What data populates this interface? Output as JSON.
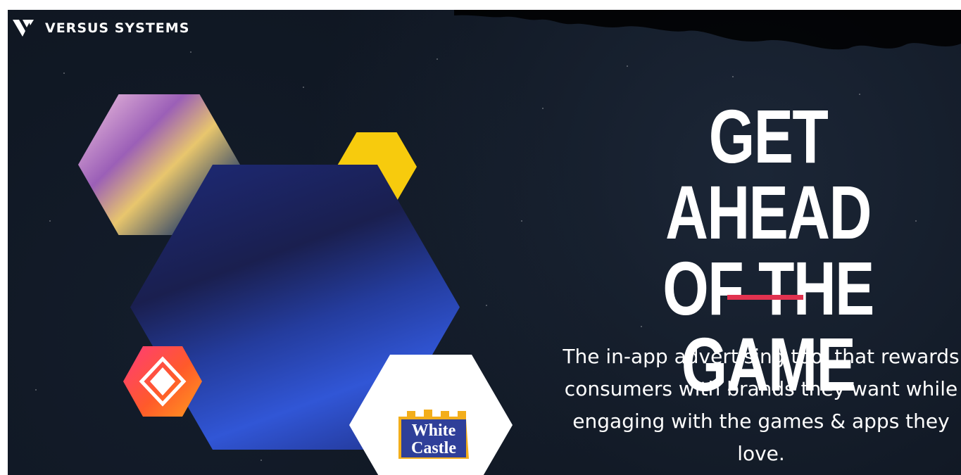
{
  "brand": {
    "name": "VERSUS SYSTEMS",
    "logo_icon": "versus-v-logo-icon"
  },
  "hero": {
    "headline_line1": "GET AHEAD",
    "headline_line2": "OF THE GAME",
    "tagline": "The in-app advertising tool that rewards consumers with brands they want while engaging with the games & apps they love.",
    "accent_color": "#e2324f",
    "background_color": "#0f1621"
  },
  "collage": {
    "hex_top": "game-characters-image",
    "hex_yellow": "yellow-hexagon",
    "hex_main": "gamer-girl-image",
    "hex_badge": "hyperx-style-badge-icon",
    "hex_white_logo_line1": "White",
    "hex_white_logo_line2": "Castle"
  }
}
